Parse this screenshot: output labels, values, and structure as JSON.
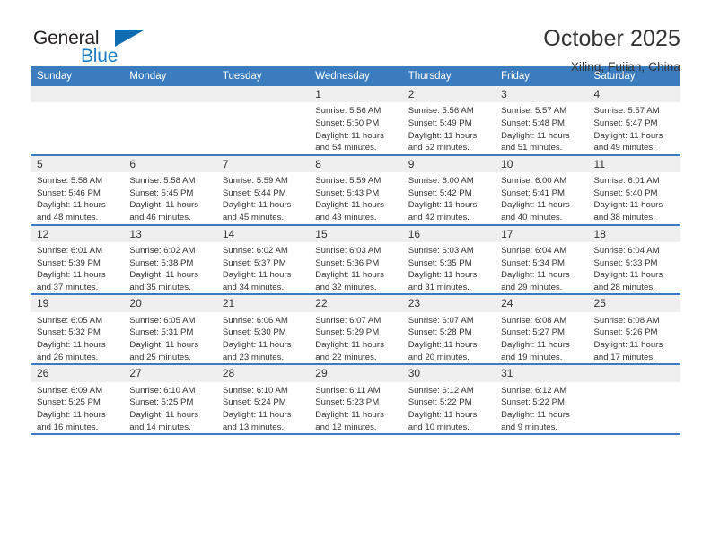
{
  "brand": {
    "word_one": "General",
    "word_two": "Blue",
    "triangle_icon": "triangle-icon",
    "accent_color": "#1b7fc4"
  },
  "header": {
    "title": "October 2025",
    "subtitle": "Xiling, Fujian, China"
  },
  "theme": {
    "header_blue": "#3a7cbe",
    "daynum_gray": "#efefef",
    "text": "#333333"
  },
  "weekdays": [
    "Sunday",
    "Monday",
    "Tuesday",
    "Wednesday",
    "Thursday",
    "Friday",
    "Saturday"
  ],
  "labels": {
    "sunrise_prefix": "Sunrise:",
    "sunset_prefix": "Sunset:",
    "daylight_prefix": "Daylight:"
  },
  "weeks": [
    [
      {
        "day": "",
        "sunrise": "",
        "sunset": "",
        "daylight": ""
      },
      {
        "day": "",
        "sunrise": "",
        "sunset": "",
        "daylight": ""
      },
      {
        "day": "",
        "sunrise": "",
        "sunset": "",
        "daylight": ""
      },
      {
        "day": "1",
        "sunrise": "Sunrise: 5:56 AM",
        "sunset": "Sunset: 5:50 PM",
        "daylight": "Daylight: 11 hours and 54 minutes."
      },
      {
        "day": "2",
        "sunrise": "Sunrise: 5:56 AM",
        "sunset": "Sunset: 5:49 PM",
        "daylight": "Daylight: 11 hours and 52 minutes."
      },
      {
        "day": "3",
        "sunrise": "Sunrise: 5:57 AM",
        "sunset": "Sunset: 5:48 PM",
        "daylight": "Daylight: 11 hours and 51 minutes."
      },
      {
        "day": "4",
        "sunrise": "Sunrise: 5:57 AM",
        "sunset": "Sunset: 5:47 PM",
        "daylight": "Daylight: 11 hours and 49 minutes."
      }
    ],
    [
      {
        "day": "5",
        "sunrise": "Sunrise: 5:58 AM",
        "sunset": "Sunset: 5:46 PM",
        "daylight": "Daylight: 11 hours and 48 minutes."
      },
      {
        "day": "6",
        "sunrise": "Sunrise: 5:58 AM",
        "sunset": "Sunset: 5:45 PM",
        "daylight": "Daylight: 11 hours and 46 minutes."
      },
      {
        "day": "7",
        "sunrise": "Sunrise: 5:59 AM",
        "sunset": "Sunset: 5:44 PM",
        "daylight": "Daylight: 11 hours and 45 minutes."
      },
      {
        "day": "8",
        "sunrise": "Sunrise: 5:59 AM",
        "sunset": "Sunset: 5:43 PM",
        "daylight": "Daylight: 11 hours and 43 minutes."
      },
      {
        "day": "9",
        "sunrise": "Sunrise: 6:00 AM",
        "sunset": "Sunset: 5:42 PM",
        "daylight": "Daylight: 11 hours and 42 minutes."
      },
      {
        "day": "10",
        "sunrise": "Sunrise: 6:00 AM",
        "sunset": "Sunset: 5:41 PM",
        "daylight": "Daylight: 11 hours and 40 minutes."
      },
      {
        "day": "11",
        "sunrise": "Sunrise: 6:01 AM",
        "sunset": "Sunset: 5:40 PM",
        "daylight": "Daylight: 11 hours and 38 minutes."
      }
    ],
    [
      {
        "day": "12",
        "sunrise": "Sunrise: 6:01 AM",
        "sunset": "Sunset: 5:39 PM",
        "daylight": "Daylight: 11 hours and 37 minutes."
      },
      {
        "day": "13",
        "sunrise": "Sunrise: 6:02 AM",
        "sunset": "Sunset: 5:38 PM",
        "daylight": "Daylight: 11 hours and 35 minutes."
      },
      {
        "day": "14",
        "sunrise": "Sunrise: 6:02 AM",
        "sunset": "Sunset: 5:37 PM",
        "daylight": "Daylight: 11 hours and 34 minutes."
      },
      {
        "day": "15",
        "sunrise": "Sunrise: 6:03 AM",
        "sunset": "Sunset: 5:36 PM",
        "daylight": "Daylight: 11 hours and 32 minutes."
      },
      {
        "day": "16",
        "sunrise": "Sunrise: 6:03 AM",
        "sunset": "Sunset: 5:35 PM",
        "daylight": "Daylight: 11 hours and 31 minutes."
      },
      {
        "day": "17",
        "sunrise": "Sunrise: 6:04 AM",
        "sunset": "Sunset: 5:34 PM",
        "daylight": "Daylight: 11 hours and 29 minutes."
      },
      {
        "day": "18",
        "sunrise": "Sunrise: 6:04 AM",
        "sunset": "Sunset: 5:33 PM",
        "daylight": "Daylight: 11 hours and 28 minutes."
      }
    ],
    [
      {
        "day": "19",
        "sunrise": "Sunrise: 6:05 AM",
        "sunset": "Sunset: 5:32 PM",
        "daylight": "Daylight: 11 hours and 26 minutes."
      },
      {
        "day": "20",
        "sunrise": "Sunrise: 6:05 AM",
        "sunset": "Sunset: 5:31 PM",
        "daylight": "Daylight: 11 hours and 25 minutes."
      },
      {
        "day": "21",
        "sunrise": "Sunrise: 6:06 AM",
        "sunset": "Sunset: 5:30 PM",
        "daylight": "Daylight: 11 hours and 23 minutes."
      },
      {
        "day": "22",
        "sunrise": "Sunrise: 6:07 AM",
        "sunset": "Sunset: 5:29 PM",
        "daylight": "Daylight: 11 hours and 22 minutes."
      },
      {
        "day": "23",
        "sunrise": "Sunrise: 6:07 AM",
        "sunset": "Sunset: 5:28 PM",
        "daylight": "Daylight: 11 hours and 20 minutes."
      },
      {
        "day": "24",
        "sunrise": "Sunrise: 6:08 AM",
        "sunset": "Sunset: 5:27 PM",
        "daylight": "Daylight: 11 hours and 19 minutes."
      },
      {
        "day": "25",
        "sunrise": "Sunrise: 6:08 AM",
        "sunset": "Sunset: 5:26 PM",
        "daylight": "Daylight: 11 hours and 17 minutes."
      }
    ],
    [
      {
        "day": "26",
        "sunrise": "Sunrise: 6:09 AM",
        "sunset": "Sunset: 5:25 PM",
        "daylight": "Daylight: 11 hours and 16 minutes."
      },
      {
        "day": "27",
        "sunrise": "Sunrise: 6:10 AM",
        "sunset": "Sunset: 5:25 PM",
        "daylight": "Daylight: 11 hours and 14 minutes."
      },
      {
        "day": "28",
        "sunrise": "Sunrise: 6:10 AM",
        "sunset": "Sunset: 5:24 PM",
        "daylight": "Daylight: 11 hours and 13 minutes."
      },
      {
        "day": "29",
        "sunrise": "Sunrise: 6:11 AM",
        "sunset": "Sunset: 5:23 PM",
        "daylight": "Daylight: 11 hours and 12 minutes."
      },
      {
        "day": "30",
        "sunrise": "Sunrise: 6:12 AM",
        "sunset": "Sunset: 5:22 PM",
        "daylight": "Daylight: 11 hours and 10 minutes."
      },
      {
        "day": "31",
        "sunrise": "Sunrise: 6:12 AM",
        "sunset": "Sunset: 5:22 PM",
        "daylight": "Daylight: 11 hours and 9 minutes."
      },
      {
        "day": "",
        "sunrise": "",
        "sunset": "",
        "daylight": ""
      }
    ]
  ]
}
